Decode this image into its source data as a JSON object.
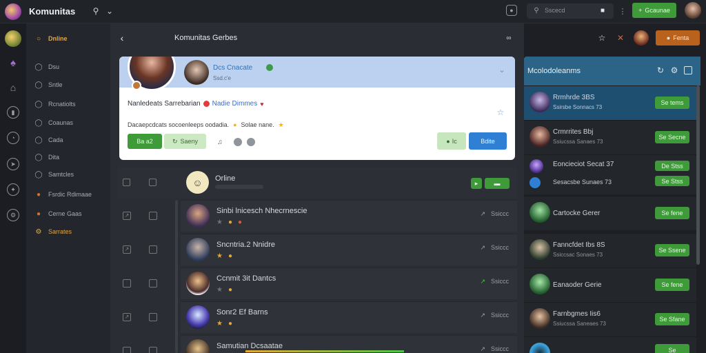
{
  "app": {
    "title": "Komunitas"
  },
  "topbar": {
    "search_placeholder": "Sscecd",
    "primary_button": "Gcaunae"
  },
  "sidebar": {
    "items": [
      {
        "label": "Dnline",
        "icon": "chat-icon"
      },
      {
        "label": "Dsu",
        "icon": "chat-icon"
      },
      {
        "label": "Sntle",
        "icon": "chat-icon"
      },
      {
        "label": "Rcnatiolts",
        "icon": "chat-icon"
      },
      {
        "label": "Coaunas",
        "icon": "chat-icon"
      },
      {
        "label": "Cada",
        "icon": "chat-icon"
      },
      {
        "label": "Dita",
        "icon": "chat-icon"
      },
      {
        "label": "Samtcles",
        "icon": "chat-icon"
      },
      {
        "label": "Fsrdic Rdimaae",
        "icon": "flame-icon"
      },
      {
        "label": "Cerne Gaas",
        "icon": "flame-icon"
      },
      {
        "label": "Sarrates",
        "icon": "gear-icon"
      }
    ]
  },
  "center": {
    "header_title": "Komunitas Gerbes",
    "profile": {
      "name": "Dcs Cnacate",
      "subtitle": "Ssd.c'e",
      "line1": "Nanledeats Sarrebarian",
      "line1_tag": "Nadie Dimmes",
      "line2": "Dacaepcdcats socoenleeps oodadia.",
      "line2_tail": "Solae nane.",
      "btn_primary": "Ba a2",
      "btn_secondary": "Saeny",
      "btn_follow": "Ic",
      "btn_message": "Bdite"
    },
    "online_label": "Orline",
    "rows": [
      {
        "name": "Sinbi lnicesch Nhecrnescie",
        "action": "Ssiccc"
      },
      {
        "name": "Sncntria.2 Nnidre",
        "action": "Ssiccc"
      },
      {
        "name": "Ccnmit 3it Dantcs",
        "action": "Ssiccc"
      },
      {
        "name": "Sonr2 Ef Barns",
        "action": "Ssiccc"
      },
      {
        "name": "Samutian Dcsaatae",
        "action": "Ssiccc"
      }
    ]
  },
  "right": {
    "header_label": "Fenta",
    "section_title": "Mcolodoleanms",
    "items": [
      {
        "t1": "Rrmhrde 3BS",
        "t2": "Ssirsbe Sonnacs 73",
        "btn": "Se tems"
      },
      {
        "t1": "Crmrrites Bbj",
        "t2": "Ssiucssa Sanaes 73",
        "btn": "Se Secne"
      },
      {
        "t1": "Eoncieciot Secat 37",
        "t2": "Sesacsbe Sunaes 73",
        "btn": "De Stss"
      },
      {
        "t1": "Cartocke Gerer",
        "t2": "",
        "btn": "Se fene"
      },
      {
        "t1": "Fanncfdet Ibs 8S",
        "t2": "Ssiccsac Sonaes 73",
        "btn": "Se Ssene"
      },
      {
        "t1": "Eanaoder Gerie",
        "t2": "",
        "btn": "Se fene"
      },
      {
        "t1": "Farnbgmes Iis6",
        "t2": "Ssiucssa Saneaes 73",
        "btn": "Se Sfane"
      }
    ]
  }
}
